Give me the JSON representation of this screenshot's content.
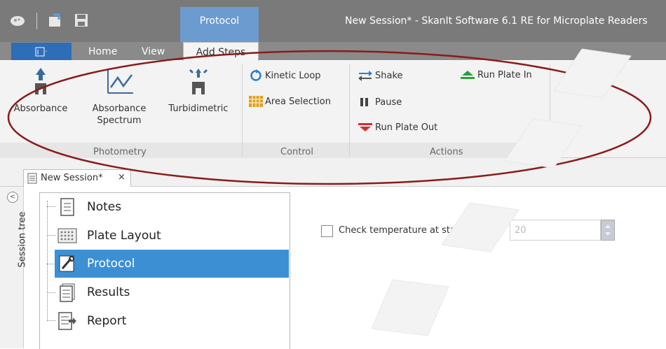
{
  "titlebar": {
    "title": "New Session* - SkanIt Software 6.1 RE for Microplate Readers",
    "context_tab": "Protocol"
  },
  "ribbon_tabs": {
    "home": "Home",
    "view": "View",
    "add_steps": "Add Steps"
  },
  "ribbon": {
    "photometry": {
      "label": "Photometry",
      "absorbance": "Absorbance",
      "absorbance_spectrum_1": "Absorbance",
      "absorbance_spectrum_2": "Spectrum",
      "turbidimetric": "Turbidimetric"
    },
    "control": {
      "label": "Control",
      "kinetic_loop": "Kinetic Loop",
      "area_selection": "Area Selection"
    },
    "actions": {
      "label": "Actions",
      "shake": "Shake",
      "pause": "Pause",
      "run_plate_out": "Run Plate Out",
      "run_plate_in": "Run Plate In"
    }
  },
  "document_tab": {
    "label": "New Session*",
    "close": "×"
  },
  "session_tree": {
    "label": "Session tree",
    "items": [
      {
        "label": "Notes",
        "icon": "notes-icon"
      },
      {
        "label": "Plate Layout",
        "icon": "plate-layout-icon"
      },
      {
        "label": "Protocol",
        "icon": "protocol-icon",
        "selected": true
      },
      {
        "label": "Results",
        "icon": "results-icon"
      },
      {
        "label": "Report",
        "icon": "report-icon"
      }
    ]
  },
  "main": {
    "check_temperature_label": "Check temperature at start [°C]:",
    "temperature_value": "20",
    "check_temperature_checked": false
  },
  "colors": {
    "titlebar": "#7a7a7a",
    "context_tab": "#6c9bd0",
    "file_button": "#2e6db8",
    "selection": "#3d8fd3",
    "annotation_ellipse": "#8b1a1a"
  }
}
